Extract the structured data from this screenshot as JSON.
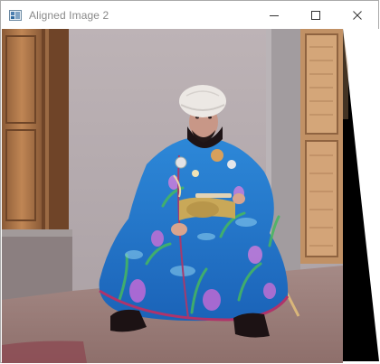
{
  "window": {
    "title": "Aligned Image 2",
    "icons": {
      "app": "image-window-icon",
      "minimize": "minimize-icon",
      "maximize": "maximize-icon",
      "close": "close-icon"
    }
  },
  "image": {
    "subject": "aligned-color-photograph"
  }
}
